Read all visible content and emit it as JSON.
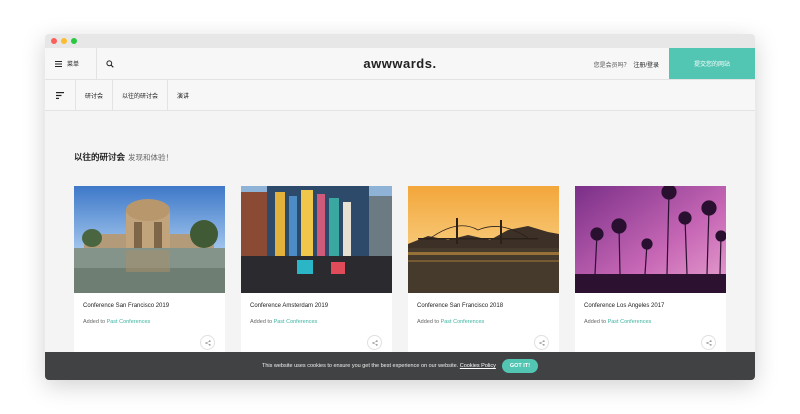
{
  "window": {
    "dots": [
      "#fc5f57",
      "#fdbc2e",
      "#28c840"
    ]
  },
  "header": {
    "menu_label": "菜单",
    "logo": "awwwards.",
    "member_text": "您是会员吗？",
    "login_label": "注册/登录",
    "submit_label": "提交您的网站",
    "accent": "#52c5b3"
  },
  "subnav": {
    "tabs": [
      {
        "label": "研讨会"
      },
      {
        "label": "以往的研讨会"
      },
      {
        "label": "演讲"
      }
    ]
  },
  "main": {
    "title": "以往的研讨会",
    "subtitle": "发现和体验！",
    "cards": [
      {
        "title": "Conference San Francisco 2019",
        "added_prefix": "Added to",
        "added_link": "Past Conferences"
      },
      {
        "title": "Conference Amsterdam 2019",
        "added_prefix": "Added to",
        "added_link": "Past Conferences"
      },
      {
        "title": "Conference San Francisco 2018",
        "added_prefix": "Added to",
        "added_link": "Past Conferences"
      },
      {
        "title": "Conference Los Angeles 2017",
        "added_prefix": "Added to",
        "added_link": "Past Conferences"
      }
    ]
  },
  "cookie": {
    "message": "This website uses cookies to ensure you get the best experience on our website.",
    "policy_label": "Cookies Policy",
    "button_label": "GOT IT!"
  }
}
